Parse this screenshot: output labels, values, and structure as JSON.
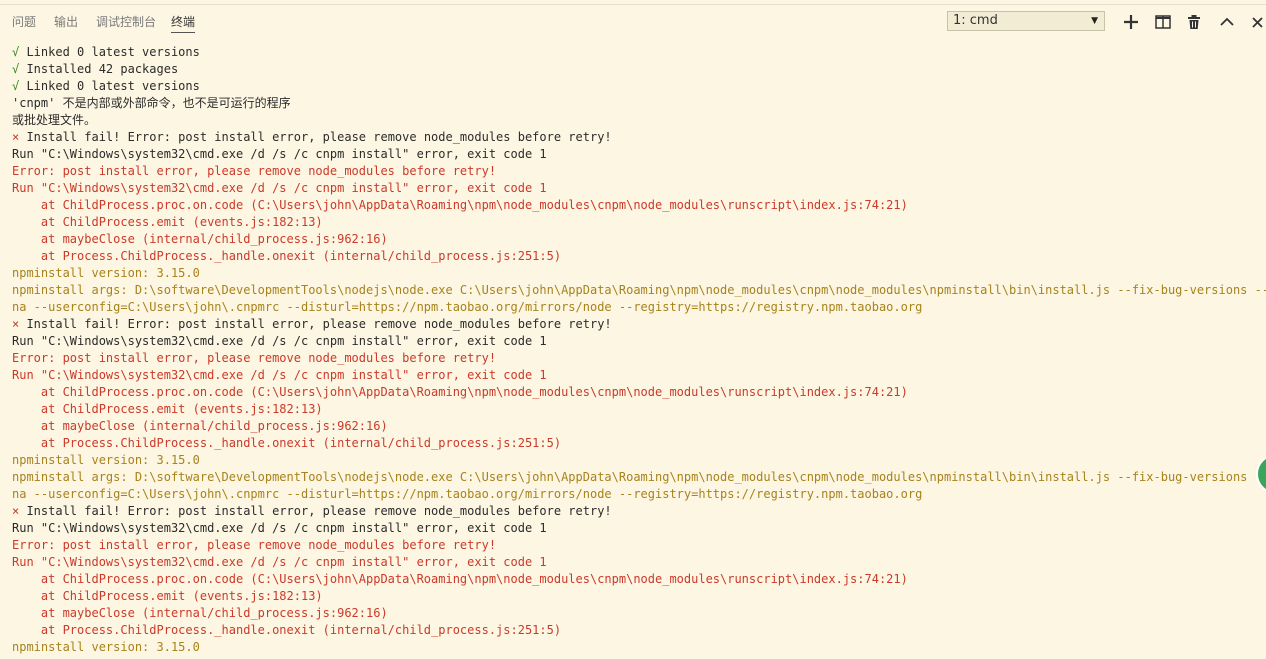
{
  "panel": {
    "tabs": [
      {
        "label": "问题"
      },
      {
        "label": "输出"
      },
      {
        "label": "调试控制台"
      },
      {
        "label": "终端"
      }
    ],
    "active_tab": "终端",
    "terminal_select": {
      "value": "1: cmd"
    },
    "toolbar_icons": [
      "plus-icon",
      "split-icon",
      "trash-icon",
      "chevron-up-icon",
      "close-icon"
    ]
  },
  "colors": {
    "background": "#fdf6e3",
    "normal": "#2b2b2b",
    "green": "#2e8b1e",
    "red": "#cb3a2a",
    "yellow": "#a7831c"
  },
  "terminal": {
    "lines": [
      {
        "text": "√ Linked 0 latest versions",
        "style": "green_check"
      },
      {
        "text": "√ Installed 42 packages",
        "style": "green_check"
      },
      {
        "text": "√ Linked 0 latest versions",
        "style": "green_check"
      },
      {
        "text": "'cnpm' 不是内部或外部命令，也不是可运行的程序",
        "style": "normal"
      },
      {
        "text": "或批处理文件。",
        "style": "normal"
      },
      {
        "text": "× Install fail! Error: post install error, please remove node_modules before retry!",
        "style": "red_x"
      },
      {
        "text": "Run \"C:\\Windows\\system32\\cmd.exe /d /s /c cnpm install\" error, exit code 1",
        "style": "normal"
      },
      {
        "text": "Error: post install error, please remove node_modules before retry!",
        "style": "red"
      },
      {
        "text": "Run \"C:\\Windows\\system32\\cmd.exe /d /s /c cnpm install\" error, exit code 1",
        "style": "red"
      },
      {
        "text": "    at ChildProcess.proc.on.code (C:\\Users\\john\\AppData\\Roaming\\npm\\node_modules\\cnpm\\node_modules\\runscript\\index.js:74:21)",
        "style": "red"
      },
      {
        "text": "    at ChildProcess.emit (events.js:182:13)",
        "style": "red"
      },
      {
        "text": "    at maybeClose (internal/child_process.js:962:16)",
        "style": "red"
      },
      {
        "text": "    at Process.ChildProcess._handle.onexit (internal/child_process.js:251:5)",
        "style": "red"
      },
      {
        "text": "npminstall version: 3.15.0",
        "style": "yellow"
      },
      {
        "text": "npminstall args: D:\\software\\DevelopmentTools\\nodejs\\node.exe C:\\Users\\john\\AppData\\Roaming\\npm\\node_modules\\cnpm\\node_modules\\npminstall\\bin\\install.js --fix-bug-versions --chi",
        "style": "yellow"
      },
      {
        "text": "na --userconfig=C:\\Users\\john\\.cnpmrc --disturl=https://npm.taobao.org/mirrors/node --registry=https://registry.npm.taobao.org",
        "style": "yellow"
      },
      {
        "text": "× Install fail! Error: post install error, please remove node_modules before retry!",
        "style": "red_x"
      },
      {
        "text": "Run \"C:\\Windows\\system32\\cmd.exe /d /s /c cnpm install\" error, exit code 1",
        "style": "normal"
      },
      {
        "text": "Error: post install error, please remove node_modules before retry!",
        "style": "red"
      },
      {
        "text": "Run \"C:\\Windows\\system32\\cmd.exe /d /s /c cnpm install\" error, exit code 1",
        "style": "red"
      },
      {
        "text": "    at ChildProcess.proc.on.code (C:\\Users\\john\\AppData\\Roaming\\npm\\node_modules\\cnpm\\node_modules\\runscript\\index.js:74:21)",
        "style": "red"
      },
      {
        "text": "    at ChildProcess.emit (events.js:182:13)",
        "style": "red"
      },
      {
        "text": "    at maybeClose (internal/child_process.js:962:16)",
        "style": "red"
      },
      {
        "text": "    at Process.ChildProcess._handle.onexit (internal/child_process.js:251:5)",
        "style": "red"
      },
      {
        "text": "npminstall version: 3.15.0",
        "style": "yellow"
      },
      {
        "text": "npminstall args: D:\\software\\DevelopmentTools\\nodejs\\node.exe C:\\Users\\john\\AppData\\Roaming\\npm\\node_modules\\cnpm\\node_modules\\npminstall\\bin\\install.js --fix-bug-versions --chi",
        "style": "yellow"
      },
      {
        "text": "na --userconfig=C:\\Users\\john\\.cnpmrc --disturl=https://npm.taobao.org/mirrors/node --registry=https://registry.npm.taobao.org",
        "style": "yellow"
      },
      {
        "text": "× Install fail! Error: post install error, please remove node_modules before retry!",
        "style": "red_x"
      },
      {
        "text": "Run \"C:\\Windows\\system32\\cmd.exe /d /s /c cnpm install\" error, exit code 1",
        "style": "normal"
      },
      {
        "text": "Error: post install error, please remove node_modules before retry!",
        "style": "red"
      },
      {
        "text": "Run \"C:\\Windows\\system32\\cmd.exe /d /s /c cnpm install\" error, exit code 1",
        "style": "red"
      },
      {
        "text": "    at ChildProcess.proc.on.code (C:\\Users\\john\\AppData\\Roaming\\npm\\node_modules\\cnpm\\node_modules\\runscript\\index.js:74:21)",
        "style": "red"
      },
      {
        "text": "    at ChildProcess.emit (events.js:182:13)",
        "style": "red"
      },
      {
        "text": "    at maybeClose (internal/child_process.js:962:16)",
        "style": "red"
      },
      {
        "text": "    at Process.ChildProcess._handle.onexit (internal/child_process.js:251:5)",
        "style": "red"
      },
      {
        "text": "npminstall version: 3.15.0",
        "style": "yellow"
      }
    ]
  }
}
